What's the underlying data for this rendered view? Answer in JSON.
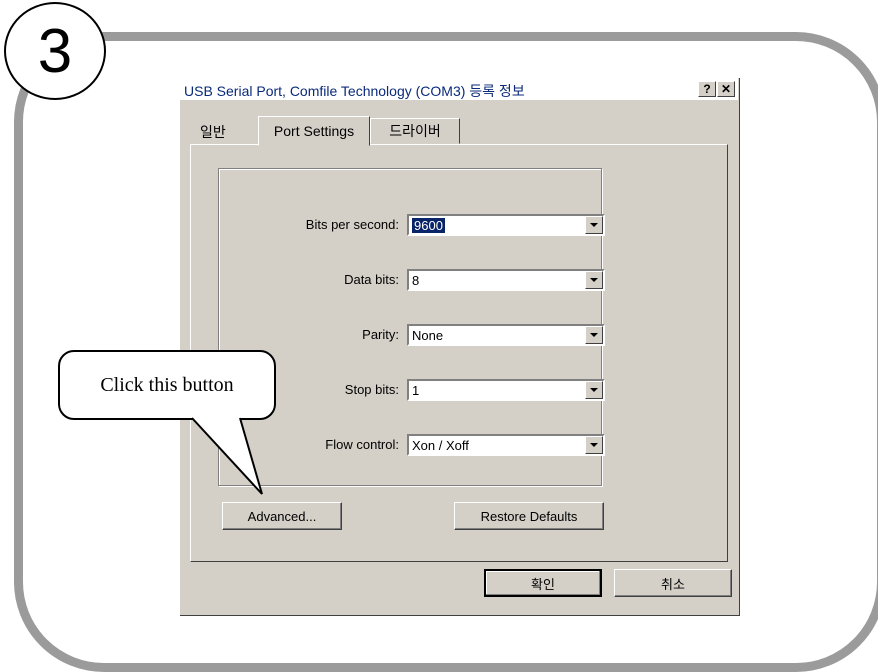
{
  "step_number": "3",
  "dialog": {
    "title": "USB Serial Port, Comfile Technology (COM3) 등록 정보",
    "help_glyph": "?",
    "close_glyph": "✕",
    "tabs": [
      "일반",
      "Port Settings",
      "드라이버"
    ],
    "active_tab": "Port Settings",
    "fields": [
      {
        "label": "Bits per second:",
        "value": "9600",
        "selected": true
      },
      {
        "label": "Data bits:",
        "value": "8"
      },
      {
        "label": "Parity:",
        "value": "None"
      },
      {
        "label": "Stop bits:",
        "value": "1"
      },
      {
        "label": "Flow control:",
        "value": "Xon / Xoff"
      }
    ],
    "buttons": {
      "advanced": "Advanced...",
      "restore": "Restore Defaults",
      "ok": "확인",
      "cancel": "취소"
    }
  },
  "callout": {
    "text": "Click this button"
  },
  "colors": {
    "frame": "#9b9b9b",
    "dialog_face": "#d4d0c8",
    "selection": "#0a246a",
    "title_text": "#0a2a7a"
  }
}
